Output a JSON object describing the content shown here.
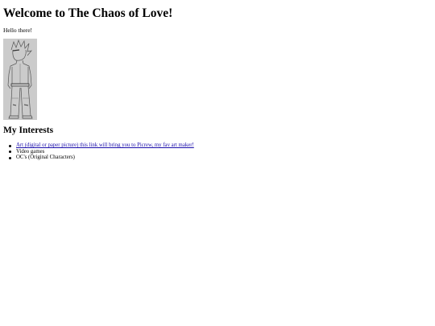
{
  "page": {
    "title": "Welcome to The Chaos of Love!",
    "greeting": "Hello there!"
  },
  "image": {
    "description": ""
  },
  "interests": {
    "heading": "My Interests",
    "items": [
      {
        "label": "Art (digital or paper picture) this link will bring you to Picrew, my fav art maker!",
        "is_link": true
      },
      {
        "label": "Video games",
        "is_link": false
      },
      {
        "label": "OC's (Original Characters)",
        "is_link": false
      }
    ]
  }
}
